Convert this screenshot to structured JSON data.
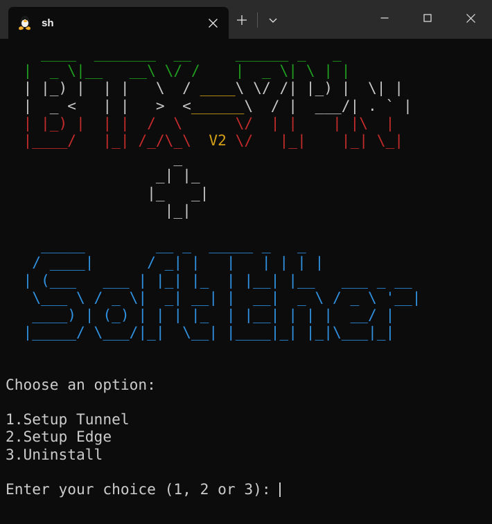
{
  "window": {
    "titlebar_bg": "#2b2b2b",
    "terminal_bg": "#0c0c0c",
    "controls": {
      "minimize_label": "Minimize",
      "maximize_label": "Maximize",
      "close_label": "Close"
    }
  },
  "tabs": [
    {
      "title": "sh",
      "icon": "tux-penguin-icon",
      "close_label": "Close tab",
      "active": true
    }
  ],
  "tabbar": {
    "new_tab_label": "+",
    "dropdown_label": "v"
  },
  "colors": {
    "green": "#1f9e1f",
    "white": "#c8c8c8",
    "red": "#c42b2b",
    "yellow": "#d4a017",
    "blue": "#2f91e0",
    "text": "#cccccc"
  },
  "terminal": {
    "banner_rtxvpn": {
      "name": "RTX-VPN",
      "version_tag": "V2",
      "lines": [
        [
          {
            "t": "   ",
            "c": "txt"
          },
          {
            "t": " ____  _______  __",
            "c": "green"
          },
          {
            "t": "     ",
            "c": "txt"
          },
          {
            "t": "______ _   _ ",
            "c": "green"
          }
        ],
        [
          {
            "t": "  ",
            "c": "txt"
          },
          {
            "t": "|  _ \\|__   __\\ \\/ /",
            "c": "green"
          },
          {
            "t": "    ",
            "c": "txt"
          },
          {
            "t": "|  _ \\| \\ | |",
            "c": "green"
          }
        ],
        [
          {
            "t": "  | |_) |  | |   \\  / ",
            "c": "white"
          },
          {
            "t": "____",
            "c": "yellow"
          },
          {
            "t": "\\ \\/ /| |_) |  \\| |",
            "c": "white"
          }
        ],
        [
          {
            "t": "  |  _ <   | |   >  <",
            "c": "white"
          },
          {
            "t": "______",
            "c": "yellow"
          },
          {
            "t": "\\  / |  ___/| . ` |",
            "c": "white"
          }
        ],
        [
          {
            "t": "  | |_) |  | |  /  \\  ",
            "c": "red"
          },
          {
            "t": "    ",
            "c": "txt"
          },
          {
            "t": "\\/  | |    | |\\  |",
            "c": "red"
          }
        ],
        [
          {
            "t": "  |____/   |_| /_/\\_\\ ",
            "c": "red"
          },
          {
            "t": " V2 ",
            "c": "yellow"
          },
          {
            "t": "\\/   |_|    |_| \\_|",
            "c": "red"
          }
        ]
      ]
    },
    "separator_plus": {
      "name": "plus-symbol",
      "lines": [
        "                   _           ",
        "                 _| |_         ",
        "                |_   _|        ",
        "                  |_|          "
      ]
    },
    "banner_softether": {
      "name": "SoftEther",
      "lines": [
        "    _____        __ _  _____ _   _               ",
        "   / ____|      / _| |   |   | | | |              ",
        "  | (___   ___ | |_| |_  | |__| |__   ___ _ __    ",
        "   \\___ \\ / _ \\|  _| __| |  __|  _ \\ / _ \\ '__|   ",
        "   ____) | (_) | | | |_  | |__| | | |  __/ |      ",
        "  |_____/ \\___/|_|  \\__| |____|_| |_|\\___|_|      "
      ]
    },
    "prompt_block": {
      "heading": "Choose an option:",
      "options": [
        "1.Setup Tunnel",
        "2.Setup Edge",
        "3.Uninstall"
      ],
      "input_prompt": "Enter your choice (1, 2 or 3): ",
      "input_value": ""
    }
  }
}
